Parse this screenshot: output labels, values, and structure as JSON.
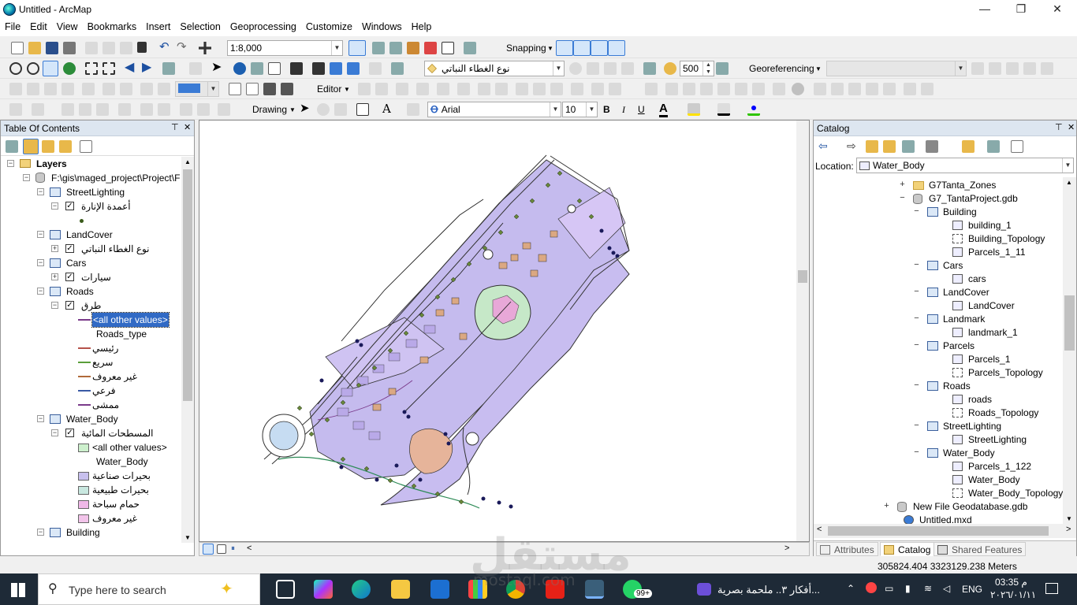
{
  "window": {
    "title": "Untitled - ArcMap",
    "minimize": "—",
    "maximize": "❐",
    "close": "✕"
  },
  "menu": [
    "File",
    "Edit",
    "View",
    "Bookmarks",
    "Insert",
    "Selection",
    "Geoprocessing",
    "Customize",
    "Windows",
    "Help"
  ],
  "toolbar": {
    "scale": "1:8,000",
    "snapping_label": "Snapping",
    "layer_combo": "نوع الغطاء النباتي",
    "buffer_value": "500",
    "georef_label": "Georeferencing",
    "editor_label": "Editor",
    "drawing_label": "Drawing",
    "font_name": "Arial",
    "font_size": "10",
    "bold": "B",
    "italic": "I",
    "underline": "U",
    "text_tool": "A"
  },
  "toc": {
    "title": "Table Of Contents",
    "pin": "⊤",
    "close": "✕",
    "layers_root": "Layers",
    "path": "F:\\gis\\maged_project\\Project\\F",
    "items": {
      "streetlighting": "StreetLighting",
      "streetlighting_sub": "أعمدة الإنارة",
      "landcover": "LandCover",
      "landcover_sub": "نوع الغطاء النباتي",
      "cars": "Cars",
      "cars_sub": "سيارات",
      "roads": "Roads",
      "roads_sub": "طرق",
      "roads_all_other": "<all other values>",
      "roads_field": "Roads_type",
      "roads_classes": [
        "رئيسي",
        "سريع",
        "غير معروف",
        "فرعي",
        "ممشى"
      ],
      "water": "Water_Body",
      "water_sub": "المسطحات المائية",
      "water_all_other": "<all other values>",
      "water_field": "Water_Body",
      "water_classes": [
        "بحيرات صناعية",
        "بحيرات طبيعية",
        "حمام سباحة",
        "غير معروف"
      ],
      "building": "Building"
    },
    "road_colors": [
      "#b5524a",
      "#5a9e3a",
      "#b06a3a",
      "#3a5aa5",
      "#7a3a8a"
    ],
    "water_colors": [
      "#c8c0ee",
      "#c9e8e0",
      "#f0b8e8",
      "#f2c4ea"
    ]
  },
  "catalog": {
    "title": "Catalog",
    "location_label": "Location:",
    "location_value": "Water_Body",
    "tree": {
      "g7zones": "G7Tanta_Zones",
      "gdb": "G7_TantaProject.gdb",
      "building": "Building",
      "building_1": "building_1",
      "building_topology": "Building_Topology",
      "parcels_1_11": "Parcels_1_11",
      "cars": "Cars",
      "cars_fc": "cars",
      "landcover": "LandCover",
      "landcover_fc": "LandCover",
      "landmark": "Landmark",
      "landmark_1": "landmark_1",
      "parcels": "Parcels",
      "parcels_1": "Parcels_1",
      "parcels_topology": "Parcels_Topology",
      "roads": "Roads",
      "roads_fc": "roads",
      "roads_topology": "Roads_Topology",
      "streetlighting": "StreetLighting",
      "streetlighting_fc": "StreetLighting",
      "water_body": "Water_Body",
      "parcels_1_122": "Parcels_1_122",
      "water_body_fc": "Water_Body",
      "water_body_topology": "Water_Body_Topology",
      "new_gdb": "New File Geodatabase.gdb",
      "mxd": "Untitled.mxd"
    },
    "tabs": [
      "Attributes",
      "Catalog",
      "Shared Features"
    ]
  },
  "status": {
    "coordinates": "305824.404  3323129.238 Meters"
  },
  "taskbar": {
    "search_placeholder": "Type here to search",
    "notification": "أفكار ٣.. ملحمة بصرية...",
    "language": "ENG",
    "time": "م 03:35",
    "date": "٢٠٢٦/٠١/١١",
    "whatsapp_badge": "99+"
  },
  "watermark": {
    "arabic": "مستقل",
    "latin": "mostaql.com"
  }
}
